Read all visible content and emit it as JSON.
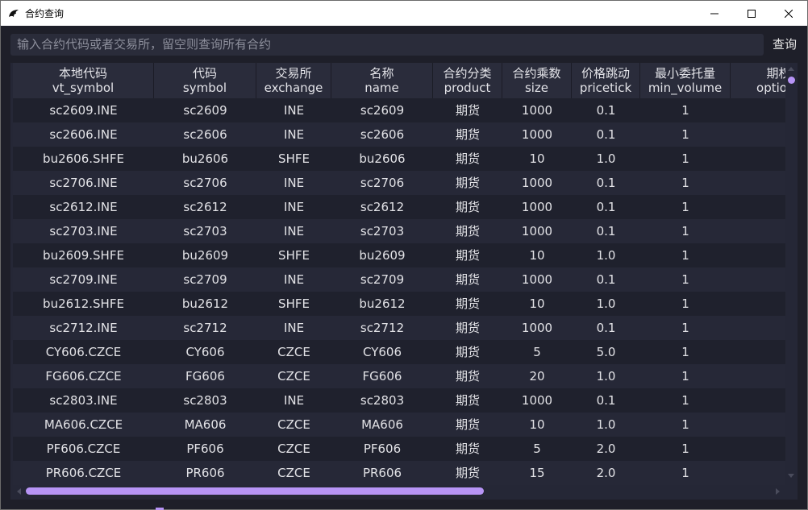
{
  "window": {
    "title": "合约查询",
    "controls": {
      "minimize": "minimize-icon",
      "maximize": "maximize-icon",
      "close": "close-icon"
    }
  },
  "search": {
    "placeholder": "输入合约代码或者交易所，留空则查询所有合约",
    "button_label": "查询"
  },
  "table": {
    "columns": [
      {
        "cn": "本地代码",
        "en": "vt_symbol"
      },
      {
        "cn": "代码",
        "en": "symbol"
      },
      {
        "cn": "交易所",
        "en": "exchange"
      },
      {
        "cn": "名称",
        "en": "name"
      },
      {
        "cn": "合约分类",
        "en": "product"
      },
      {
        "cn": "合约乘数",
        "en": "size"
      },
      {
        "cn": "价格跳动",
        "en": "pricetick"
      },
      {
        "cn": "最小委托量",
        "en": "min_volume"
      },
      {
        "cn": "期权",
        "en": "option_"
      }
    ],
    "rows": [
      [
        "sc2609.INE",
        "sc2609",
        "INE",
        "sc2609",
        "期货",
        "1000",
        "0.1",
        "1",
        ""
      ],
      [
        "sc2606.INE",
        "sc2606",
        "INE",
        "sc2606",
        "期货",
        "1000",
        "0.1",
        "1",
        ""
      ],
      [
        "bu2606.SHFE",
        "bu2606",
        "SHFE",
        "bu2606",
        "期货",
        "10",
        "1.0",
        "1",
        ""
      ],
      [
        "sc2706.INE",
        "sc2706",
        "INE",
        "sc2706",
        "期货",
        "1000",
        "0.1",
        "1",
        ""
      ],
      [
        "sc2612.INE",
        "sc2612",
        "INE",
        "sc2612",
        "期货",
        "1000",
        "0.1",
        "1",
        ""
      ],
      [
        "sc2703.INE",
        "sc2703",
        "INE",
        "sc2703",
        "期货",
        "1000",
        "0.1",
        "1",
        ""
      ],
      [
        "bu2609.SHFE",
        "bu2609",
        "SHFE",
        "bu2609",
        "期货",
        "10",
        "1.0",
        "1",
        ""
      ],
      [
        "sc2709.INE",
        "sc2709",
        "INE",
        "sc2709",
        "期货",
        "1000",
        "0.1",
        "1",
        ""
      ],
      [
        "bu2612.SHFE",
        "bu2612",
        "SHFE",
        "bu2612",
        "期货",
        "10",
        "1.0",
        "1",
        ""
      ],
      [
        "sc2712.INE",
        "sc2712",
        "INE",
        "sc2712",
        "期货",
        "1000",
        "0.1",
        "1",
        ""
      ],
      [
        "CY606.CZCE",
        "CY606",
        "CZCE",
        "CY606",
        "期货",
        "5",
        "5.0",
        "1",
        ""
      ],
      [
        "FG606.CZCE",
        "FG606",
        "CZCE",
        "FG606",
        "期货",
        "20",
        "1.0",
        "1",
        ""
      ],
      [
        "sc2803.INE",
        "sc2803",
        "INE",
        "sc2803",
        "期货",
        "1000",
        "0.1",
        "1",
        ""
      ],
      [
        "MA606.CZCE",
        "MA606",
        "CZCE",
        "MA606",
        "期货",
        "10",
        "1.0",
        "1",
        ""
      ],
      [
        "PF606.CZCE",
        "PF606",
        "CZCE",
        "PF606",
        "期货",
        "5",
        "2.0",
        "1",
        ""
      ],
      [
        "PR606.CZCE",
        "PR606",
        "CZCE",
        "PR606",
        "期货",
        "15",
        "2.0",
        "1",
        ""
      ]
    ]
  },
  "colors": {
    "accent": "#b794f6",
    "background": "#1e1f29",
    "row_odd": "#1f212d",
    "row_even": "#262837"
  }
}
